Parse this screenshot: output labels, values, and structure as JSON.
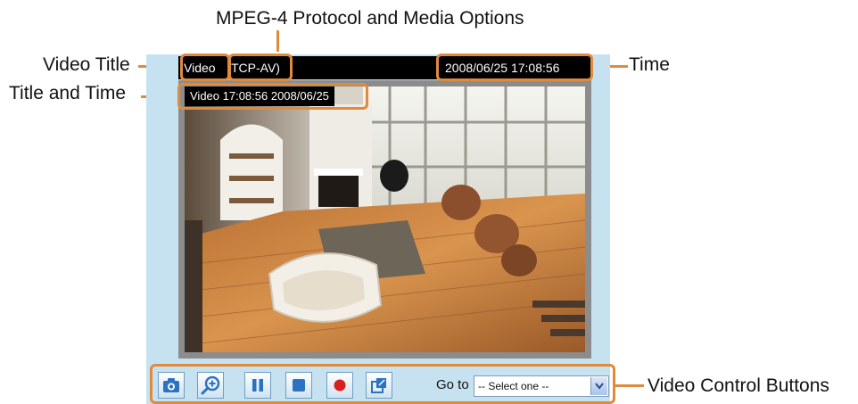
{
  "callouts": {
    "protocol": "MPEG-4 Protocol and Media Options",
    "video_title": "Video Title",
    "title_and_time": "Title and Time",
    "time": "Time",
    "video_controls": "Video Control Buttons"
  },
  "viewer": {
    "title": "Video",
    "protocol": "TCP-AV)",
    "datetime": "2008/06/25 17:08:56",
    "overlay_text": "Video 17:08:56  2008/06/25"
  },
  "controls": {
    "buttons": [
      {
        "name": "snapshot-icon"
      },
      {
        "name": "digital-zoom-icon"
      },
      {
        "name": "pause-icon"
      },
      {
        "name": "stop-icon"
      },
      {
        "name": "record-icon"
      },
      {
        "name": "fullscreen-icon"
      }
    ],
    "goto_label": "Go to",
    "goto_select": "-- Select one --"
  },
  "colors": {
    "accent": "#e08a3c",
    "panel": "#c6e2f0",
    "button_icon": "#2b73c2"
  }
}
